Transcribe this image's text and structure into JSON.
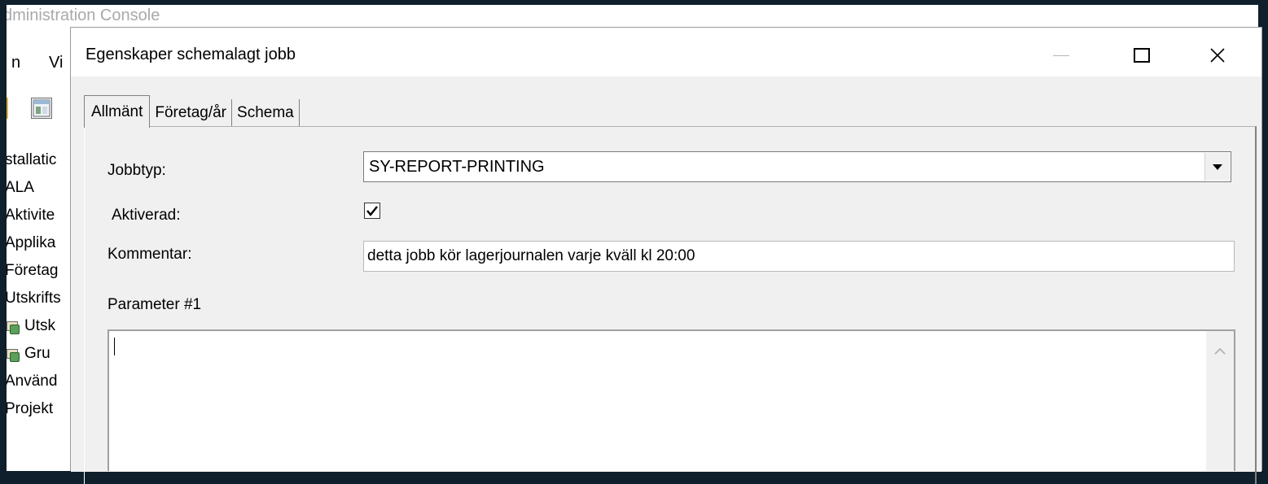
{
  "background_window": {
    "title": "dministration Console",
    "menu": [
      "n",
      "Vi"
    ],
    "tree_items": [
      {
        "label": "stallatic",
        "icon": ""
      },
      {
        "label": "ALA",
        "icon": ""
      },
      {
        "label": "Aktivite",
        "icon": ""
      },
      {
        "label": "Applika",
        "icon": ""
      },
      {
        "label": "Företag",
        "icon": ""
      },
      {
        "label": "Utskrifts",
        "icon": ""
      },
      {
        "label": "Utsk",
        "icon": "printer-document-icon"
      },
      {
        "label": "Gru",
        "icon": "printer-document-icon"
      },
      {
        "label": "Använd",
        "icon": ""
      },
      {
        "label": "Projekt",
        "icon": ""
      }
    ]
  },
  "dialog": {
    "title": "Egenskaper schemalagt jobb",
    "tabs": [
      {
        "label": "Allmänt",
        "active": true
      },
      {
        "label": "Företag/år",
        "active": false
      },
      {
        "label": "Schema",
        "active": false
      }
    ],
    "fields": {
      "jobbtyp_label": "Jobbtyp:",
      "jobbtyp_value": "SY-REPORT-PRINTING",
      "aktiverad_label": "Aktiverad:",
      "aktiverad_checked": true,
      "kommentar_label": "Kommentar:",
      "kommentar_value": "detta jobb kör lagerjournalen varje kväll kl 20:00",
      "parameter_label": "Parameter #1",
      "parameter_value": ""
    }
  },
  "colors": {
    "desktop_background": "#0f1f2b",
    "dialog_client": "#f0f0f0"
  }
}
